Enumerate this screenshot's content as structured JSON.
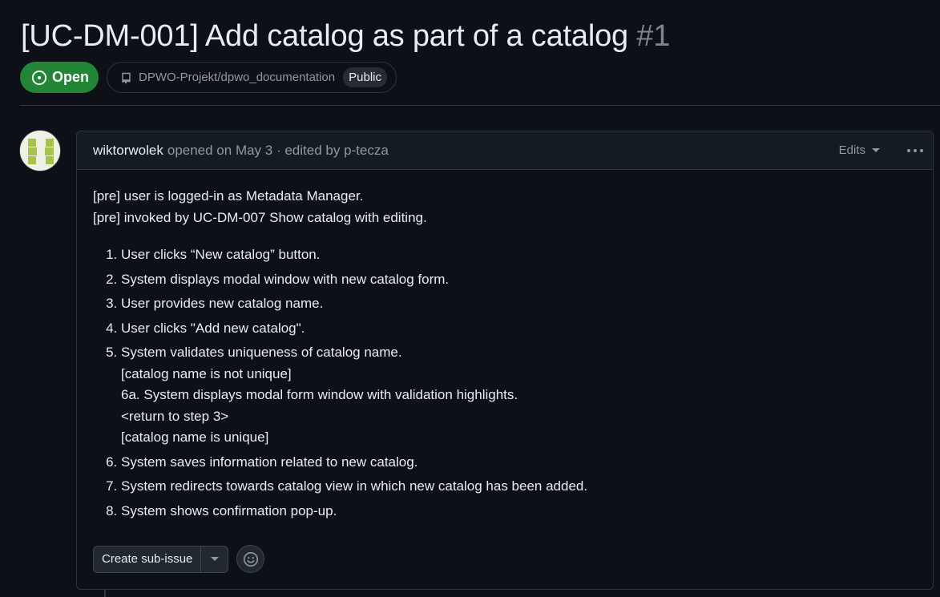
{
  "issue": {
    "title": "[UC-DM-001] Add catalog as part of a catalog",
    "number": "#1",
    "state": "Open",
    "repository": "DPWO-Projekt/dpwo_documentation",
    "visibility": "Public"
  },
  "comment": {
    "author": "wiktorwolek",
    "meta": "opened on May 3 · edited by p-tecza",
    "edits_label": "Edits",
    "pre_lines": [
      "[pre] user is logged-in as Metadata Manager.",
      "[pre] invoked by UC-DM-007 Show catalog with editing."
    ],
    "steps": [
      "User clicks “New catalog” button.",
      "System displays modal window with new catalog form.",
      "User provides new catalog name.",
      "User clicks \"Add new catalog\".",
      "System validates uniqueness of catalog name.",
      "System saves information related to new catalog.",
      "System redirects towards catalog view in which new catalog has been added.",
      "System shows confirmation pop-up."
    ],
    "step5_sub": [
      "[catalog name is not unique]",
      "6a. System displays modal form window with validation highlights.",
      "<return to step 3>",
      "[catalog name is unique]"
    ]
  },
  "actions": {
    "create_sub_issue": "Create sub-issue"
  },
  "colors": {
    "background": "#0d1117",
    "open_badge": "#238636",
    "border": "#30363d",
    "muted_text": "#9198a1"
  }
}
